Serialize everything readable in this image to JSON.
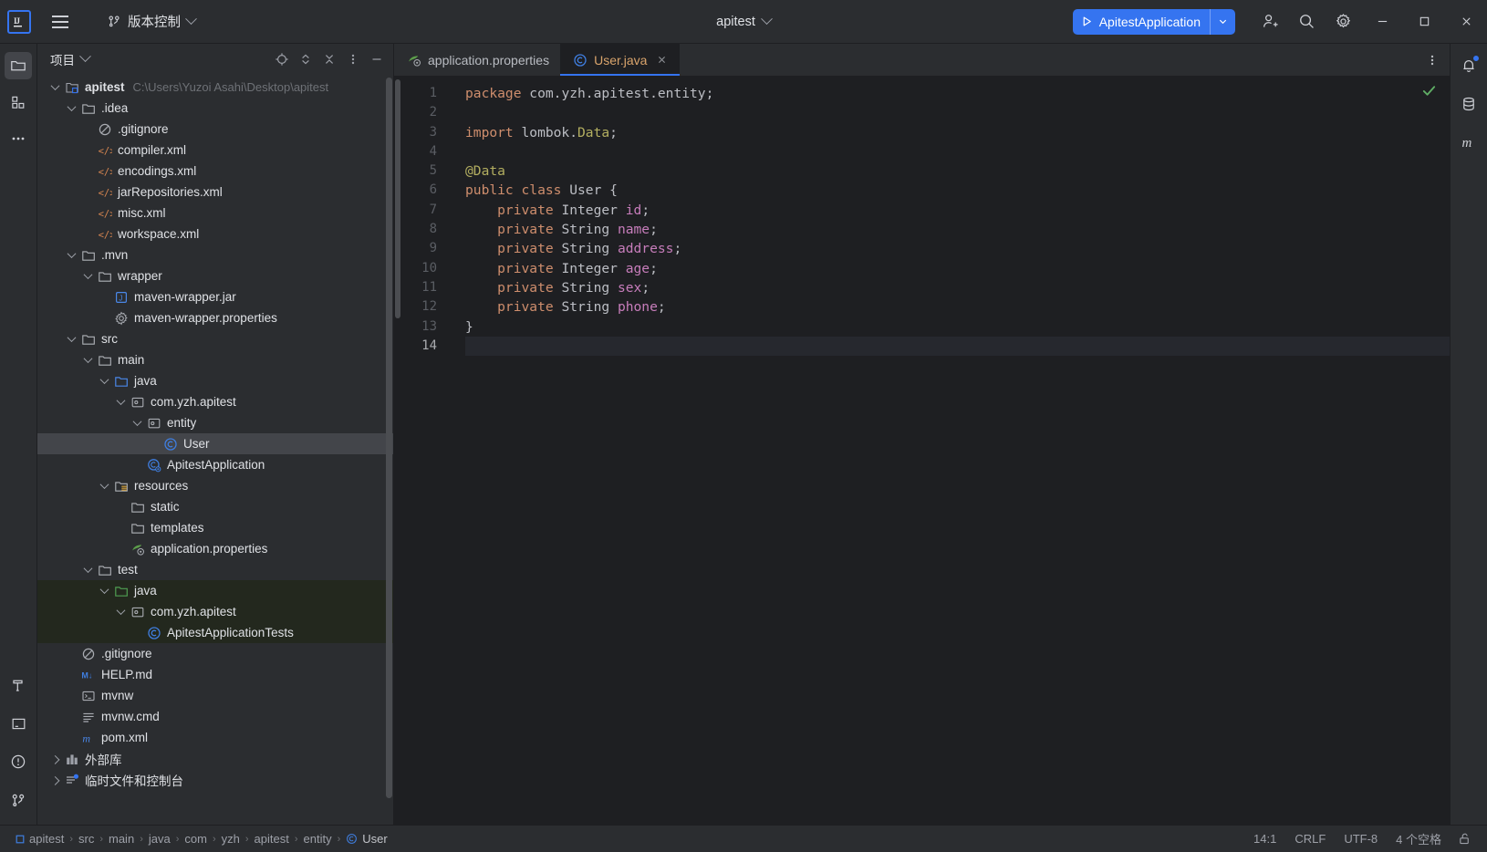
{
  "titlebar": {
    "logo_alt": "IJ",
    "menu_label": "main-menu",
    "vcs_label": "版本控制",
    "project_name": "apitest",
    "run_config_name": "ApitestApplication",
    "icons": {
      "account": "account-add-icon",
      "search": "search-icon",
      "settings": "gear-icon",
      "minimize": "minimize-icon",
      "maximize": "maximize-icon",
      "close": "close-icon"
    },
    "accent_color": "#3574f0"
  },
  "left_toolstrip": [
    {
      "name": "project-tool-window",
      "icon": "folder-icon",
      "active": true
    },
    {
      "name": "commit-tool-window",
      "icon": "structure-squares-icon",
      "active": false
    },
    {
      "name": "more-tool-windows",
      "icon": "more-dots-icon",
      "active": false
    }
  ],
  "left_toolstrip_bottom": [
    {
      "name": "build-tool-window",
      "icon": "hammer-icon"
    },
    {
      "name": "terminal-tool-window",
      "icon": "terminal-icon"
    },
    {
      "name": "problems-tool-window",
      "icon": "warning-circle-icon"
    },
    {
      "name": "version-control-tool-window",
      "icon": "git-branch-icon"
    }
  ],
  "right_toolstrip": [
    {
      "name": "notifications-tool-window",
      "icon": "bell-icon",
      "badge": true
    },
    {
      "name": "database-tool-window",
      "icon": "database-icon",
      "badge": false
    },
    {
      "name": "maven-tool-window",
      "icon": "maven-m-icon",
      "badge": false
    }
  ],
  "project_panel": {
    "title": "项目",
    "actions": [
      {
        "name": "select-opened-file-button",
        "icon": "target-icon"
      },
      {
        "name": "expand-all-button",
        "icon": "expand-icon"
      },
      {
        "name": "collapse-all-button",
        "icon": "collapse-icon"
      },
      {
        "name": "options-button",
        "icon": "vertical-dots-icon"
      },
      {
        "name": "hide-panel-button",
        "icon": "minus-icon"
      }
    ],
    "tree": [
      {
        "label": "apitest",
        "path": "C:\\Users\\Yuzoi Asahi\\Desktop\\apitest",
        "indent": 0,
        "twisty": "down",
        "icon": "module-icon",
        "bold": true,
        "state": "normal"
      },
      {
        "label": ".idea",
        "indent": 1,
        "twisty": "down",
        "icon": "folder-icon",
        "state": "normal"
      },
      {
        "label": ".gitignore",
        "indent": 2,
        "twisty": "none",
        "icon": "gitignore-icon",
        "state": "normal"
      },
      {
        "label": "compiler.xml",
        "indent": 2,
        "twisty": "none",
        "icon": "xml-icon",
        "state": "normal"
      },
      {
        "label": "encodings.xml",
        "indent": 2,
        "twisty": "none",
        "icon": "xml-icon",
        "state": "normal"
      },
      {
        "label": "jarRepositories.xml",
        "indent": 2,
        "twisty": "none",
        "icon": "xml-icon",
        "state": "normal"
      },
      {
        "label": "misc.xml",
        "indent": 2,
        "twisty": "none",
        "icon": "xml-icon",
        "state": "normal"
      },
      {
        "label": "workspace.xml",
        "indent": 2,
        "twisty": "none",
        "icon": "xml-icon",
        "state": "normal"
      },
      {
        "label": ".mvn",
        "indent": 1,
        "twisty": "down",
        "icon": "folder-icon",
        "state": "normal"
      },
      {
        "label": "wrapper",
        "indent": 2,
        "twisty": "down",
        "icon": "folder-icon",
        "state": "normal"
      },
      {
        "label": "maven-wrapper.jar",
        "indent": 3,
        "twisty": "none",
        "icon": "jar-icon",
        "state": "normal"
      },
      {
        "label": "maven-wrapper.properties",
        "indent": 3,
        "twisty": "none",
        "icon": "properties-icon",
        "state": "normal"
      },
      {
        "label": "src",
        "indent": 1,
        "twisty": "down",
        "icon": "folder-icon",
        "state": "normal"
      },
      {
        "label": "main",
        "indent": 2,
        "twisty": "down",
        "icon": "folder-icon",
        "state": "normal"
      },
      {
        "label": "java",
        "indent": 3,
        "twisty": "down",
        "icon": "source-folder-icon",
        "state": "normal"
      },
      {
        "label": "com.yzh.apitest",
        "indent": 4,
        "twisty": "down",
        "icon": "package-icon",
        "state": "normal"
      },
      {
        "label": "entity",
        "indent": 5,
        "twisty": "down",
        "icon": "package-icon",
        "state": "normal"
      },
      {
        "label": "User",
        "indent": 6,
        "twisty": "none",
        "icon": "java-class-icon",
        "state": "selected"
      },
      {
        "label": "ApitestApplication",
        "indent": 5,
        "twisty": "none",
        "icon": "spring-class-icon",
        "state": "normal"
      },
      {
        "label": "resources",
        "indent": 3,
        "twisty": "down",
        "icon": "resources-folder-icon",
        "state": "normal"
      },
      {
        "label": "static",
        "indent": 4,
        "twisty": "none",
        "icon": "folder-icon",
        "state": "normal"
      },
      {
        "label": "templates",
        "indent": 4,
        "twisty": "none",
        "icon": "folder-icon",
        "state": "normal"
      },
      {
        "label": "application.properties",
        "indent": 4,
        "twisty": "none",
        "icon": "spring-properties-icon",
        "state": "normal"
      },
      {
        "label": "test",
        "indent": 2,
        "twisty": "down",
        "icon": "folder-icon",
        "state": "normal"
      },
      {
        "label": "java",
        "indent": 3,
        "twisty": "down",
        "icon": "test-source-folder-icon",
        "state": "testsrc"
      },
      {
        "label": "com.yzh.apitest",
        "indent": 4,
        "twisty": "down",
        "icon": "package-icon",
        "state": "testsrc"
      },
      {
        "label": "ApitestApplicationTests",
        "indent": 5,
        "twisty": "none",
        "icon": "java-class-icon",
        "state": "testsrc"
      },
      {
        "label": ".gitignore",
        "indent": 1,
        "twisty": "none",
        "icon": "gitignore-icon",
        "state": "normal"
      },
      {
        "label": "HELP.md",
        "indent": 1,
        "twisty": "none",
        "icon": "markdown-icon",
        "state": "normal"
      },
      {
        "label": "mvnw",
        "indent": 1,
        "twisty": "none",
        "icon": "shell-script-icon",
        "state": "normal"
      },
      {
        "label": "mvnw.cmd",
        "indent": 1,
        "twisty": "none",
        "icon": "text-file-icon",
        "state": "normal"
      },
      {
        "label": "pom.xml",
        "indent": 1,
        "twisty": "none",
        "icon": "maven-m-icon",
        "state": "normal"
      },
      {
        "label": "外部库",
        "indent": 0,
        "twisty": "right",
        "icon": "external-libraries-icon",
        "state": "normal"
      },
      {
        "label": "临时文件和控制台",
        "indent": 0,
        "twisty": "right",
        "icon": "scratches-icon",
        "state": "normal"
      }
    ]
  },
  "editor": {
    "tabs": [
      {
        "label": "application.properties",
        "icon": "spring-properties-icon",
        "active": false,
        "closable": false
      },
      {
        "label": "User.java",
        "icon": "java-class-icon",
        "active": true,
        "closable": true
      }
    ],
    "overflow_menu": "editor-tabs-options",
    "inspection_status": "ok-check-icon",
    "line_count": 14,
    "lines": [
      {
        "n": 1,
        "tokens": [
          {
            "t": "package",
            "c": "kw"
          },
          {
            "t": " com.yzh.apitest.entity;",
            "c": "pl"
          }
        ]
      },
      {
        "n": 2,
        "tokens": []
      },
      {
        "n": 3,
        "tokens": [
          {
            "t": "import",
            "c": "kw"
          },
          {
            "t": " lombok.",
            "c": "pl"
          },
          {
            "t": "Data",
            "c": "impcls"
          },
          {
            "t": ";",
            "c": "pl"
          }
        ]
      },
      {
        "n": 4,
        "tokens": []
      },
      {
        "n": 5,
        "tokens": [
          {
            "t": "@Data",
            "c": "ann"
          }
        ]
      },
      {
        "n": 6,
        "tokens": [
          {
            "t": "public class",
            "c": "kw"
          },
          {
            "t": " User {",
            "c": "pl"
          }
        ]
      },
      {
        "n": 7,
        "tokens": [
          {
            "t": "    private",
            "c": "kw"
          },
          {
            "t": " Integer ",
            "c": "pl"
          },
          {
            "t": "id",
            "c": "field"
          },
          {
            "t": ";",
            "c": "pl"
          }
        ]
      },
      {
        "n": 8,
        "tokens": [
          {
            "t": "    private",
            "c": "kw"
          },
          {
            "t": " String ",
            "c": "pl"
          },
          {
            "t": "name",
            "c": "field"
          },
          {
            "t": ";",
            "c": "pl"
          }
        ]
      },
      {
        "n": 9,
        "tokens": [
          {
            "t": "    private",
            "c": "kw"
          },
          {
            "t": " String ",
            "c": "pl"
          },
          {
            "t": "address",
            "c": "field"
          },
          {
            "t": ";",
            "c": "pl"
          }
        ]
      },
      {
        "n": 10,
        "tokens": [
          {
            "t": "    private",
            "c": "kw"
          },
          {
            "t": " Integer ",
            "c": "pl"
          },
          {
            "t": "age",
            "c": "field"
          },
          {
            "t": ";",
            "c": "pl"
          }
        ]
      },
      {
        "n": 11,
        "tokens": [
          {
            "t": "    private",
            "c": "kw"
          },
          {
            "t": " String ",
            "c": "pl"
          },
          {
            "t": "sex",
            "c": "field"
          },
          {
            "t": ";",
            "c": "pl"
          }
        ]
      },
      {
        "n": 12,
        "tokens": [
          {
            "t": "    private",
            "c": "kw"
          },
          {
            "t": " String ",
            "c": "pl"
          },
          {
            "t": "phone",
            "c": "field"
          },
          {
            "t": ";",
            "c": "pl"
          }
        ]
      },
      {
        "n": 13,
        "tokens": [
          {
            "t": "}",
            "c": "pl"
          }
        ]
      },
      {
        "n": 14,
        "tokens": []
      }
    ]
  },
  "statusbar": {
    "breadcrumbs": [
      {
        "label": "apitest",
        "icon": "module-square-icon"
      },
      {
        "label": "src",
        "icon": null
      },
      {
        "label": "main",
        "icon": null
      },
      {
        "label": "java",
        "icon": null
      },
      {
        "label": "com",
        "icon": null
      },
      {
        "label": "yzh",
        "icon": null
      },
      {
        "label": "apitest",
        "icon": null
      },
      {
        "label": "entity",
        "icon": null
      },
      {
        "label": "User",
        "icon": "java-class-icon"
      }
    ],
    "separator": "›",
    "caret_position": "14:1",
    "line_separator": "CRLF",
    "encoding": "UTF-8",
    "indent": "4 个空格",
    "lock_icon": "unlocked-icon"
  }
}
